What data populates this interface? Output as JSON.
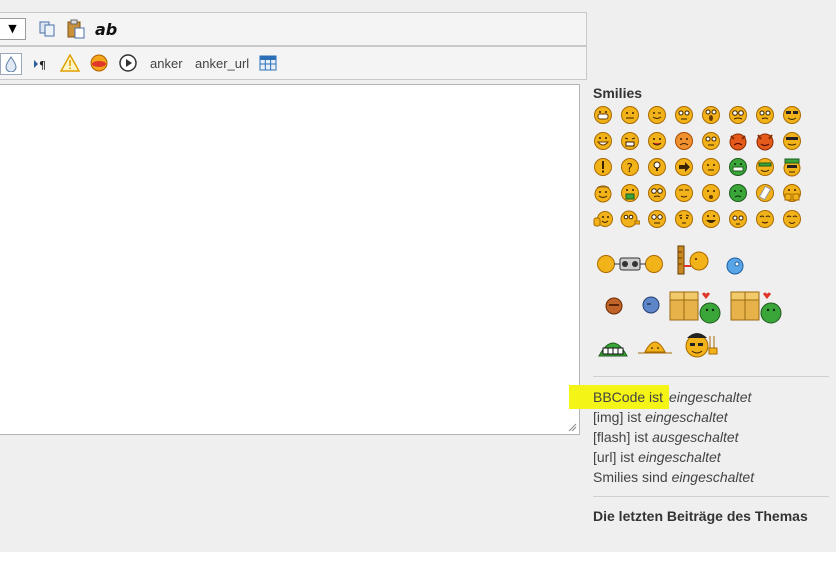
{
  "toolbar1": {
    "dropdown_arrow": "▼",
    "icons": [
      "copy-icon",
      "paste-icon"
    ],
    "ab_label": "ab"
  },
  "toolbar2": {
    "icons": [
      "color-drop-icon",
      "paragraph-icon",
      "warning-icon",
      "speech-bubble-icon",
      "play-icon"
    ],
    "anker_label": "anker",
    "anker_url_label": "anker_url",
    "table_icon": "table-icon"
  },
  "sidebar": {
    "smilies_title": "Smilies",
    "status": [
      {
        "prefix": "BBCode ist ",
        "value": "eingeschaltet"
      },
      {
        "prefix": "[img] ist ",
        "value": "eingeschaltet"
      },
      {
        "prefix": "[flash] ist ",
        "value": "ausgeschaltet"
      },
      {
        "prefix": "[url] ist ",
        "value": "eingeschaltet"
      },
      {
        "prefix": "Smilies sind ",
        "value": "eingeschaltet"
      }
    ],
    "last_posts_title": "Die letzten Beiträge des Themas"
  },
  "colors": {
    "highlight": "#f4f416",
    "smiley_yellow": "#f2b21a",
    "smiley_green": "#3aa63a",
    "link_icon_blue": "#2c6fb7"
  }
}
